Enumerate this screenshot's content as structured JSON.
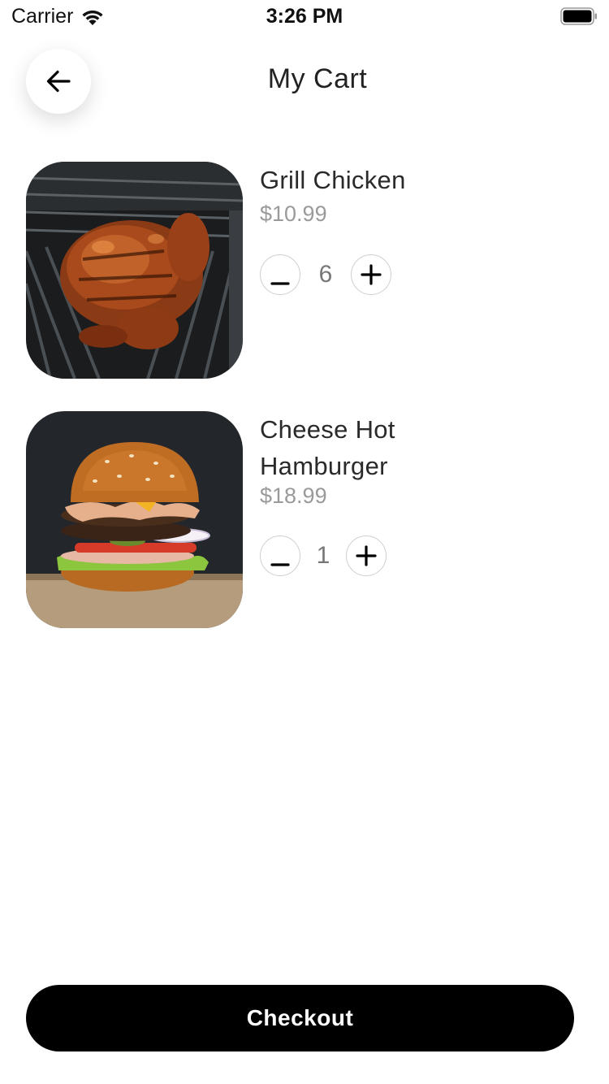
{
  "status_bar": {
    "carrier": "Carrier",
    "time": "3:26 PM",
    "wifi_icon": "wifi-icon",
    "battery_icon": "battery-full-icon"
  },
  "header": {
    "title": "My Cart",
    "back_icon": "arrow-left-icon"
  },
  "cart": {
    "items": [
      {
        "name": "Grill Chicken",
        "price": "$10.99",
        "quantity": "6",
        "image": "grilled-chicken-photo",
        "decrement_icon": "minus-icon",
        "increment_icon": "plus-icon"
      },
      {
        "name": "Cheese Hot Hamburger",
        "price": "$18.99",
        "quantity": "1",
        "image": "cheeseburger-photo",
        "decrement_icon": "minus-icon",
        "increment_icon": "plus-icon"
      }
    ]
  },
  "checkout": {
    "label": "Checkout"
  },
  "colors": {
    "primary_button": "#000000",
    "price_text": "#9a9a9a",
    "qty_text": "#777777",
    "title_text": "#222222"
  }
}
